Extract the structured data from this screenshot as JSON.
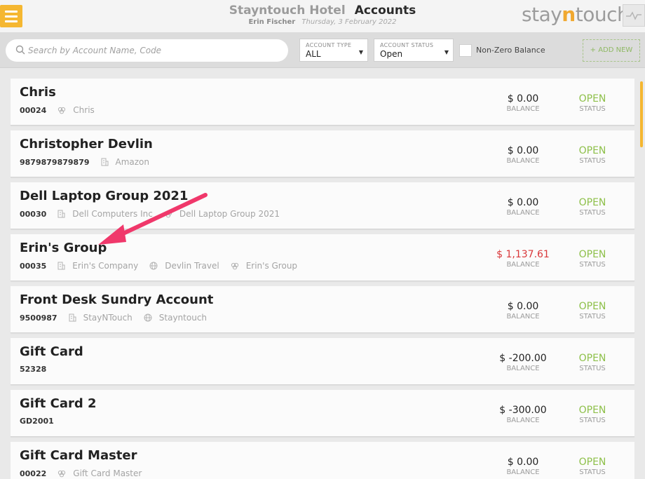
{
  "header": {
    "hotel_name": "Stayntouch Hotel",
    "page_title": "Accounts",
    "user_name": "Erin Fischer",
    "date": "Thursday, 3 February 2022",
    "logo_pre": "stay",
    "logo_n": "n",
    "logo_post": "touch"
  },
  "toolbar": {
    "search_placeholder": "Search by Account Name, Code",
    "account_type_label": "ACCOUNT TYPE",
    "account_type_value": "ALL",
    "account_status_label": "ACCOUNT STATUS",
    "account_status_value": "Open",
    "non_zero_label": "Non-Zero Balance",
    "add_new_label": "+ ADD NEW"
  },
  "labels": {
    "balance": "BALANCE",
    "status": "STATUS"
  },
  "accounts": [
    {
      "name": "Chris",
      "code": "00024",
      "company": "",
      "travel_agent": "",
      "group": "Chris",
      "balance": "$ 0.00",
      "status": "OPEN"
    },
    {
      "name": "Christopher Devlin",
      "code": "9879879879879",
      "company": "Amazon",
      "travel_agent": "",
      "group": "",
      "balance": "$ 0.00",
      "status": "OPEN"
    },
    {
      "name": "Dell Laptop Group 2021",
      "code": "00030",
      "company": "Dell Computers Inc",
      "travel_agent": "",
      "group": "Dell Laptop Group 2021",
      "balance": "$ 0.00",
      "status": "OPEN"
    },
    {
      "name": "Erin's Group",
      "code": "00035",
      "company": "Erin's Company",
      "travel_agent": "Devlin Travel",
      "group": "Erin's Group",
      "balance": "$ 1,137.61",
      "status": "OPEN"
    },
    {
      "name": "Front Desk Sundry Account",
      "code": "9500987",
      "company": "StayNTouch",
      "travel_agent": "Stayntouch",
      "group": "",
      "balance": "$ 0.00",
      "status": "OPEN"
    },
    {
      "name": "Gift Card",
      "code": "52328",
      "company": "",
      "travel_agent": "",
      "group": "",
      "balance": "$ -200.00",
      "status": "OPEN"
    },
    {
      "name": "Gift Card 2",
      "code": "GD2001",
      "company": "",
      "travel_agent": "",
      "group": "",
      "balance": "$ -300.00",
      "status": "OPEN"
    },
    {
      "name": "Gift Card Master",
      "code": "00022",
      "company": "",
      "travel_agent": "",
      "group": "Gift Card Master",
      "balance": "$ 0.00",
      "status": "OPEN"
    }
  ],
  "colors": {
    "accent": "#f5b731",
    "status_open": "#8ec04a",
    "negative_balance": "#d9383a",
    "annotation_arrow": "#f0386b"
  }
}
